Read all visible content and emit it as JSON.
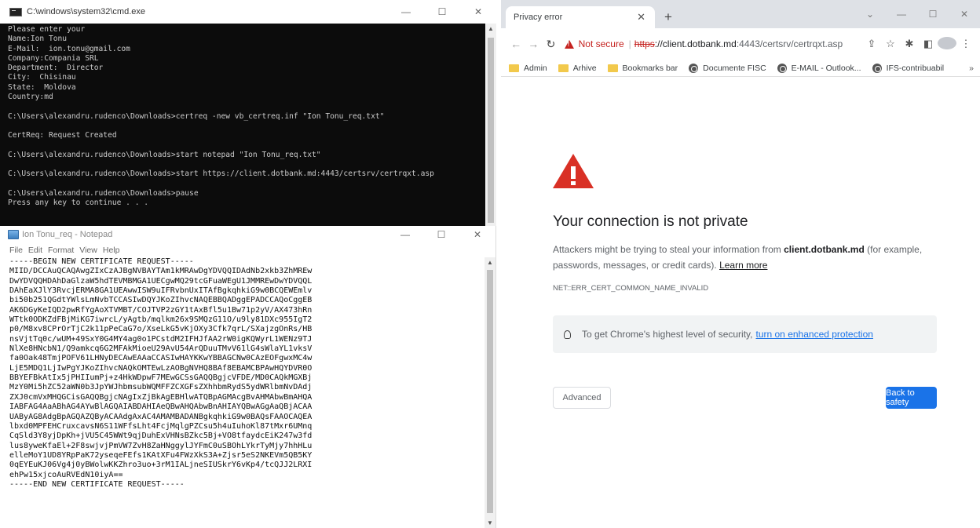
{
  "cmd": {
    "title": "C:\\windows\\system32\\cmd.exe",
    "lines": [
      "Please enter your",
      "Name:Ion Tonu",
      "E-Mail:  ion.tonu@gmail.com",
      "Company:Compania SRL",
      "Department:  Director",
      "City:  Chisinau",
      "State:  Moldova",
      "Country:md",
      "",
      "C:\\Users\\alexandru.rudenco\\Downloads>certreq -new vb_certreq.inf \"Ion Tonu_req.txt\"",
      "",
      "CertReq: Request Created",
      "",
      "C:\\Users\\alexandru.rudenco\\Downloads>start notepad \"Ion Tonu_req.txt\"",
      "",
      "C:\\Users\\alexandru.rudenco\\Downloads>start https://client.dotbank.md:4443/certsrv/certrqxt.asp",
      "",
      "C:\\Users\\alexandru.rudenco\\Downloads>pause",
      "Press any key to continue . . ."
    ]
  },
  "notepad": {
    "title": "Ion Tonu_req - Notepad",
    "menu": [
      "File",
      "Edit",
      "Format",
      "View",
      "Help"
    ],
    "lines": [
      "-----BEGIN NEW CERTIFICATE REQUEST-----",
      "MIID/DCCAuQCAQAwgZIxCzAJBgNVBAYTAm1kMRAwDgYDVQQIDAdNb2xkb3ZhMREw",
      "DwYDVQQHDAhDaGlzaW5hdTEVMBMGA1UECgwMQ29tcGFuaWEgU1JMMREwDwYDVQQL",
      "DAhEaXJlY3RvcjERMA8GA1UEAwwISW9uIFRvbnUxITAfBgkqhkiG9w0BCQEWEmlv",
      "bi50b251QGdtYWlsLmNvbTCCASIwDQYJKoZIhvcNAQEBBQADggEPADCCAQoCggEB",
      "AK6DGyKeIQD2pwRfYgAoXTVMBT/COJTVP2zGY1tAxBfl5u1Bw71p2yV/AX473hRn",
      "WTtk0ODKZdFBjMiKG7iwrcL/yAgtb/mqlkm26x9SMQzG11O/u9ly81DXc955IgT2",
      "p0/M8xv8CPrOrTjC2k11pPeCaG7o/XseLkG5vKjOXy3Cfk7qrL/SXajzgOnRs/HB",
      "nsVjtTq0c/wUM+49SxY0G4MY4ag0o1PCstdM2IFHJfAA2rW0igKQWyrL1WENz9TJ",
      "NlXe8HNcbN1/Q9amkcq6G2MFAkMioeU29AvU54ArQDuuTMvV61lG4sWlaYL1vksV",
      "fa0Oak48TmjPOFV61LHNyDECAwEAAaCCASIwHAYKKwYBBAGCNw0CAzEOFgwxMC4w",
      "LjE5MDQ1LjIwPgYJKoZIhvcNAQkOMTEwLzAOBgNVHQ8BAf8EBAMCBPAwHQYDVR0O",
      "BBYEFBkAtIx5jPHIIumPj+z4HkWDpwF7MEwGCSsGAQQBgjcVFDE/MD0CAQkMGXBj",
      "MzY0Mi5hZC52aWN0b3JpYWJhbmsubWQMFFZCXGFsZXhhbmRydS5ydWRlbmNvDAdj",
      "ZXJ0cmVxMHQGCisGAQQBgjcNAgIxZjBkAgEBHlwATQBpAGMAcgBvAHMAbwBmAHQA",
      "IABFAG4AaABhAG4AYwBlAGQAIABDAHIAeQBwAHQAbwBnAHIAYQBwAGgAaQBjACAA",
      "UAByAG8AdgBpAGQAZQByACAAdgAxAC4AMAMBADANBgkqhkiG9w0BAQsFAAOCAQEA",
      "lbxd0MPFEHCruxcavsN6S11WFfsLht4FcjMqlgPZCsu5h4uIuhoKl87tMxr6UMnq",
      "CqSld3Y8yjDpKh+jVU5C45WWt9qjDuhExVHNsBZkc5Bj+VO8tfaydcEiK247w3fd",
      "lus8yweKfaEl+2F8swjvjPmVW7ZvH8ZaHNggylJYFmC0uSBOhLYkrTyMjy7hhHLu",
      "elleMoY1UD8YRpPaK72yseqeFEfs1KAtXFu4FWzXkS3A+Zjsr5eS2NKEVm5QB5KY",
      "0qEYEuKJ06Vg4j0yBWolwKKZhro3uo+3rM1IALjneSIUSkrY6vKp4/tcQJJ2LRXI",
      "ehPw15xjcoAuRVEdN10iyA==",
      "-----END NEW CERTIFICATE REQUEST-----"
    ]
  },
  "chrome": {
    "tab_title": "Privacy error",
    "omnibox": {
      "not_secure": "Not secure",
      "scheme": "https",
      "host": "://client.dotbank.md",
      "rest": ":4443/certsrv/certrqxt.asp"
    },
    "bookmarks": [
      {
        "label": "Admin",
        "icon": "folder-icon"
      },
      {
        "label": "Arhive",
        "icon": "folder-icon"
      },
      {
        "label": "Bookmarks bar",
        "icon": "folder-icon"
      },
      {
        "label": "Documente FISC",
        "icon": "globe-icon"
      },
      {
        "label": "E-MAIL - Outlook...",
        "icon": "globe-icon"
      },
      {
        "label": "IFS-contribuabil",
        "icon": "globe-icon"
      }
    ],
    "more_bookmarks": "»",
    "page": {
      "heading": "Your connection is not private",
      "desc_before": "Attackers might be trying to steal your information from ",
      "desc_host": "client.dotbank.md",
      "desc_after": " (for example, passwords, messages, or credit cards). ",
      "learn_more": "Learn more",
      "error_code": "NET::ERR_CERT_COMMON_NAME_INVALID",
      "protection_text": "To get Chrome's highest level of security,",
      "protection_link": "turn on enhanced protection",
      "advanced_label": "Advanced",
      "back_label": "Back to safety"
    }
  },
  "colors": {
    "danger": "#d93025",
    "link_blue": "#1a73e8",
    "console_bg": "#0c0c0c",
    "console_fg": "#cccccc"
  }
}
